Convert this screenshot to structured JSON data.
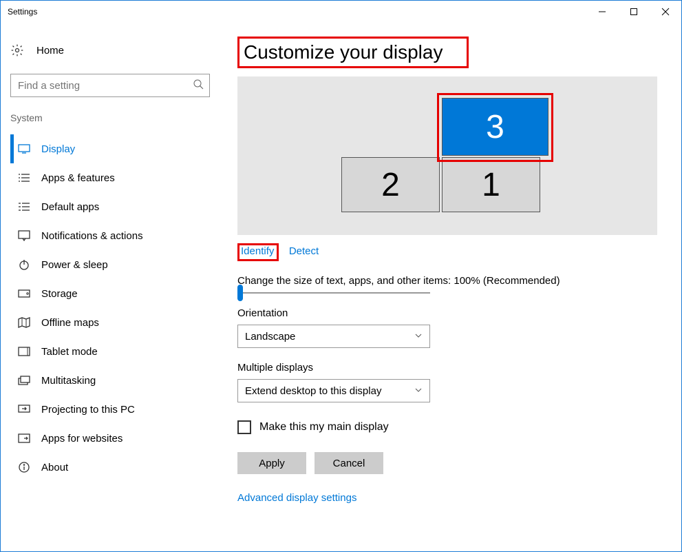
{
  "window": {
    "title": "Settings"
  },
  "sidebar": {
    "home_label": "Home",
    "search_placeholder": "Find a setting",
    "category": "System",
    "items": [
      {
        "label": "Display"
      },
      {
        "label": "Apps & features"
      },
      {
        "label": "Default apps"
      },
      {
        "label": "Notifications & actions"
      },
      {
        "label": "Power & sleep"
      },
      {
        "label": "Storage"
      },
      {
        "label": "Offline maps"
      },
      {
        "label": "Tablet mode"
      },
      {
        "label": "Multitasking"
      },
      {
        "label": "Projecting to this PC"
      },
      {
        "label": "Apps for websites"
      },
      {
        "label": "About"
      }
    ]
  },
  "main": {
    "title": "Customize your display",
    "monitors": {
      "m1": "1",
      "m2": "2",
      "m3": "3"
    },
    "identify": "Identify",
    "detect": "Detect",
    "scale_label": "Change the size of text, apps, and other items: 100% (Recommended)",
    "orientation_label": "Orientation",
    "orientation_value": "Landscape",
    "multi_label": "Multiple displays",
    "multi_value": "Extend desktop to this display",
    "main_display_checkbox": "Make this my main display",
    "apply": "Apply",
    "cancel": "Cancel",
    "advanced": "Advanced display settings"
  }
}
